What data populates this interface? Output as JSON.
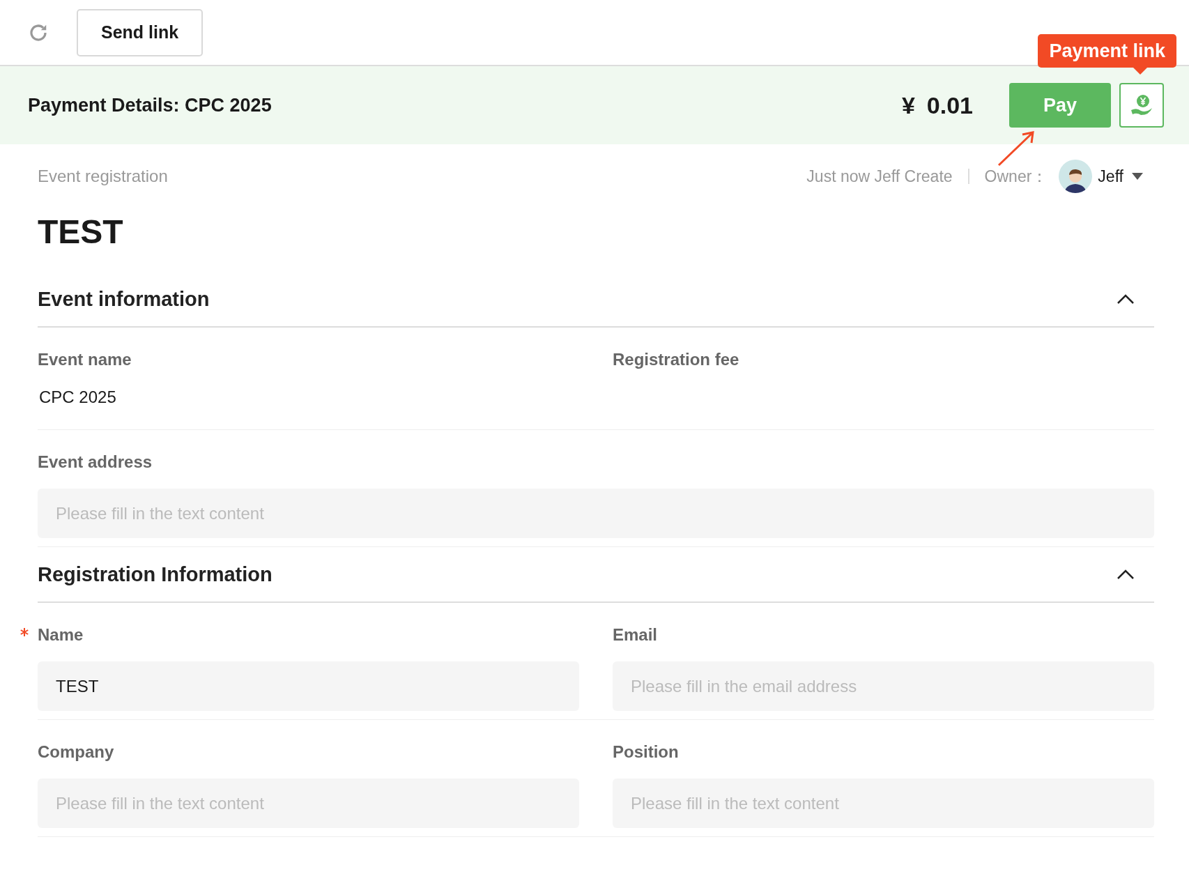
{
  "toolbar": {
    "button": "Send link"
  },
  "payment_bar": {
    "title": "Payment Details: CPC 2025",
    "currency": "¥",
    "amount": "0.01",
    "pay_button": "Pay",
    "tooltip": "Payment link"
  },
  "record": {
    "type": "Event registration",
    "meta": "Just now Jeff Create",
    "owner_label": "Owner：",
    "owner_name": "Jeff",
    "title": "TEST"
  },
  "sections": [
    {
      "title": "Event information",
      "expanded": true,
      "rows": [
        [
          {
            "label": "Event name",
            "kind": "text",
            "required": false,
            "value": "CPC 2025"
          },
          {
            "label": "Registration fee",
            "kind": "text",
            "required": false
          }
        ],
        [
          {
            "label": "Event address",
            "kind": "input",
            "required": false,
            "placeholder": "Please fill in the text content"
          }
        ]
      ]
    },
    {
      "title": "Registration Information",
      "expanded": true,
      "rows": [
        [
          {
            "label": "Name",
            "kind": "input",
            "required": true,
            "value": "TEST"
          },
          {
            "label": "Email",
            "kind": "input",
            "required": false,
            "placeholder": "Please fill in the email address"
          }
        ],
        [
          {
            "label": "Company",
            "kind": "input",
            "required": false,
            "placeholder": "Please fill in the text content"
          },
          {
            "label": "Position",
            "kind": "input",
            "required": false,
            "placeholder": "Please fill in the text content"
          }
        ]
      ]
    }
  ]
}
